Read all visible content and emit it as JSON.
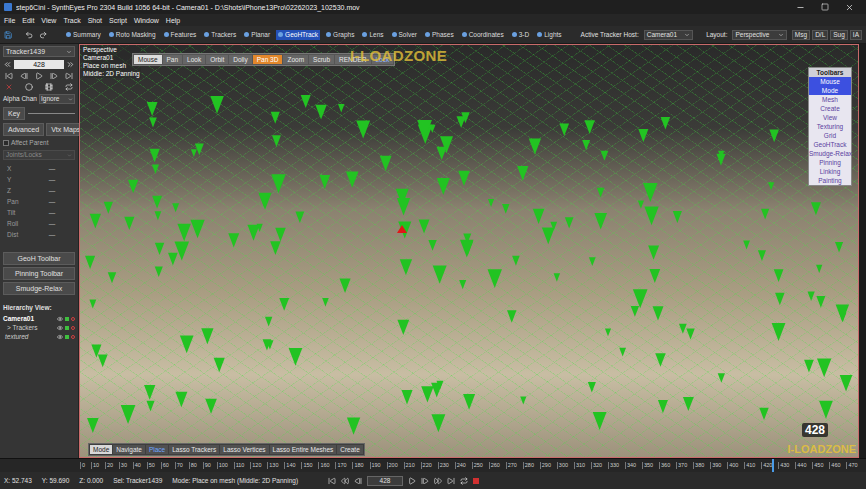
{
  "window": {
    "title": "step6Cini - SynthEyes Pro 2304 Build 1056 64-bit - Camera01 - D:\\Shots\\iPhone13Pro\\02262023_102530.mov"
  },
  "menu": [
    "File",
    "Edit",
    "View",
    "Track",
    "Shot",
    "Script",
    "Window",
    "Help"
  ],
  "rooms": [
    {
      "label": "Summary",
      "selected": false
    },
    {
      "label": "Roto Masking",
      "selected": false
    },
    {
      "label": "Features",
      "selected": false
    },
    {
      "label": "Trackers",
      "selected": false
    },
    {
      "label": "Planar",
      "selected": false
    },
    {
      "label": "GeoHTrack",
      "selected": true
    },
    {
      "label": "Graphs",
      "selected": false
    },
    {
      "label": "Lens",
      "selected": false
    },
    {
      "label": "Solver",
      "selected": false
    },
    {
      "label": "Phases",
      "selected": false
    },
    {
      "label": "Coordinates",
      "selected": false
    },
    {
      "label": "3-D",
      "selected": false
    },
    {
      "label": "Lights",
      "selected": false
    }
  ],
  "active_tracker_host": {
    "label": "Active Tracker Host:",
    "value": "Camera01"
  },
  "layout": {
    "label": "Layout:",
    "value": "Perspective"
  },
  "right_buttons": [
    "Msg",
    "D/L",
    "Sug",
    "IA"
  ],
  "left_panel": {
    "tracker": "Tracker1439",
    "frame": "428",
    "alpha_label": "Alpha Chan",
    "alpha_value": "Ignore",
    "key": "Key",
    "buttons": [
      "Advanced",
      "Vtx Maps"
    ],
    "affect_parent": {
      "label": "Affect Parent",
      "checked": false
    },
    "joints_label": "Joints/Locks",
    "fields": [
      {
        "label": "X",
        "value": "—"
      },
      {
        "label": "Y",
        "value": "—"
      },
      {
        "label": "Z",
        "value": "—"
      },
      {
        "label": "Pan",
        "value": "—"
      },
      {
        "label": "Tilt",
        "value": "—"
      },
      {
        "label": "Roll",
        "value": "—"
      },
      {
        "label": "Dist",
        "value": "—"
      }
    ],
    "tool_buttons": [
      "GeoH Toolbar",
      "Pinning Toolbar",
      "Smudge-Relax"
    ],
    "hierarchy": {
      "title": "Hierarchy View:",
      "items": [
        {
          "label": "Camera01",
          "kind": "camera",
          "selected": true
        },
        {
          "label": "> Trackers",
          "kind": "group",
          "selected": false
        },
        {
          "label": "textured",
          "kind": "mesh",
          "selected": false
        }
      ]
    }
  },
  "viewport": {
    "info": [
      "Perspective",
      "Camera01",
      "Place on mesh",
      "Middle: 2D Panning"
    ],
    "mouse_modes": [
      {
        "label": "Mouse",
        "kind": "title",
        "selected": false,
        "on": false
      },
      {
        "label": "Pan",
        "kind": "button",
        "selected": false,
        "on": false
      },
      {
        "label": "Look",
        "kind": "button",
        "selected": false,
        "on": false
      },
      {
        "label": "Orbit",
        "kind": "button",
        "selected": false,
        "on": false
      },
      {
        "label": "Dolly",
        "kind": "button",
        "selected": false,
        "on": false
      },
      {
        "label": "Pan 3D",
        "kind": "button",
        "selected": true,
        "on": false
      },
      {
        "label": "Zoom",
        "kind": "button",
        "selected": false,
        "on": false
      },
      {
        "label": "Scrub",
        "kind": "button",
        "selected": false,
        "on": false
      },
      {
        "label": "RENDER",
        "kind": "button",
        "selected": false,
        "on": false
      },
      {
        "label": "Lock",
        "kind": "toggle",
        "selected": false,
        "on": true
      }
    ],
    "toolbars_panel": {
      "title": "Toolbars",
      "items": [
        {
          "label": "Mouse",
          "selected": true
        },
        {
          "label": "Mode",
          "selected": true
        },
        {
          "label": "Mesh",
          "selected": false
        },
        {
          "label": "Create",
          "selected": false
        },
        {
          "label": "View",
          "selected": false
        },
        {
          "label": "Texturing",
          "selected": false
        },
        {
          "label": "Grid",
          "selected": false
        },
        {
          "label": "GeoHTrack",
          "selected": false
        },
        {
          "label": "Smudge-Relax",
          "selected": false
        },
        {
          "label": "Pinning",
          "selected": false
        },
        {
          "label": "Linking",
          "selected": false
        },
        {
          "label": "Painting",
          "selected": false
        }
      ]
    },
    "mode_bar": [
      {
        "label": "Mode",
        "kind": "title",
        "selected": false
      },
      {
        "label": "Navigate",
        "kind": "button",
        "selected": false
      },
      {
        "label": "Place",
        "kind": "button",
        "selected": true
      },
      {
        "label": "Lasso Trackers",
        "kind": "button",
        "selected": false
      },
      {
        "label": "Lasso Vertices",
        "kind": "button",
        "selected": false
      },
      {
        "label": "Lasso Entire Meshes",
        "kind": "button",
        "selected": false
      },
      {
        "label": "Create",
        "kind": "button",
        "selected": false
      }
    ],
    "frame_badge": "428",
    "watermarks": [
      "I-LOADZONE",
      "I-LOADZONE"
    ]
  },
  "timeline": {
    "ticks": [
      "0",
      "10",
      "20",
      "30",
      "40",
      "50",
      "60",
      "70",
      "80",
      "90",
      "100",
      "110",
      "120",
      "130",
      "140",
      "150",
      "160",
      "170",
      "180",
      "190",
      "200",
      "210",
      "220",
      "230",
      "240",
      "250",
      "260",
      "270",
      "280",
      "290",
      "300",
      "310",
      "320",
      "330",
      "340",
      "350",
      "360",
      "370",
      "380",
      "390",
      "400",
      "410",
      "420",
      "430",
      "440",
      "450",
      "460",
      "470"
    ],
    "level": 0.89
  },
  "status_bar": {
    "x": "X: 52.743",
    "y": "Y: 59.690",
    "z": "Z: 0.000",
    "selection": "Sel: Tracker1439",
    "mode": "Mode: Place on mesh (Middle: 2D Panning)",
    "frame": "428"
  }
}
